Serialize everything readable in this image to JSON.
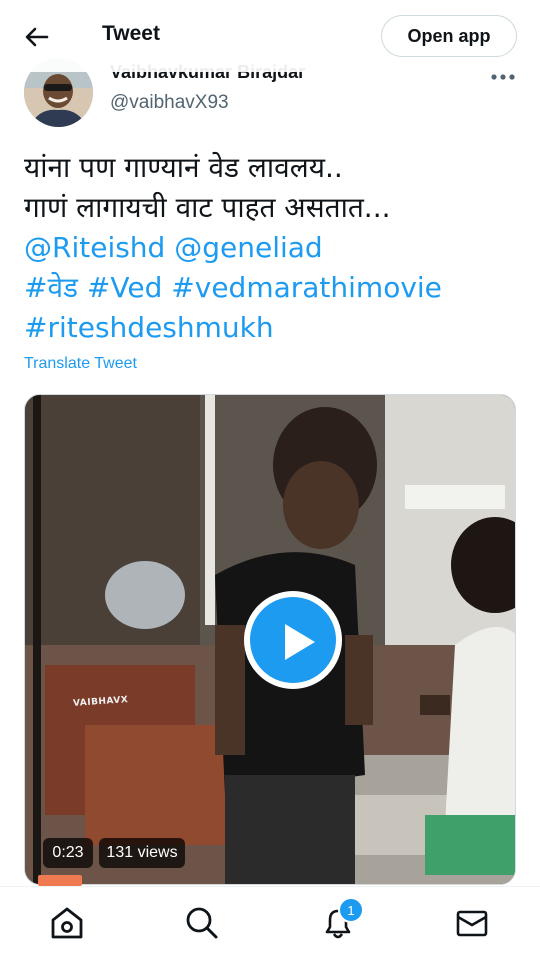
{
  "header": {
    "back_icon": "arrow-left-icon",
    "title": "Tweet",
    "open_app_label": "Open app"
  },
  "author": {
    "display_name": "Vaibhavkumar Birajdar",
    "handle": "@vaibhavX93",
    "more_icon": "more-horizontal-icon"
  },
  "tweet": {
    "line1": "यांना पण गाण्यानं वेड लावलय..",
    "line2": "गाणं लागायची वाट पाहत असतात...",
    "mentions": [
      "@Riteishd",
      "@geneliad"
    ],
    "hashtags_line1": [
      "#वेड",
      "#Ved",
      "#vedmarathimovie"
    ],
    "hashtags_line2": [
      "#riteshdeshmukh"
    ],
    "translate_label": "Translate Tweet"
  },
  "video": {
    "duration": "0:23",
    "views": "131 views",
    "watermark": "VAIBHAVX",
    "play_icon": "play-icon"
  },
  "bottom_nav": {
    "items": [
      "home-icon",
      "search-icon",
      "notifications-icon",
      "messages-icon"
    ],
    "notification_count": "1"
  },
  "colors": {
    "accent": "#1d9bf0",
    "text": "#0f1419",
    "secondary": "#536471"
  }
}
